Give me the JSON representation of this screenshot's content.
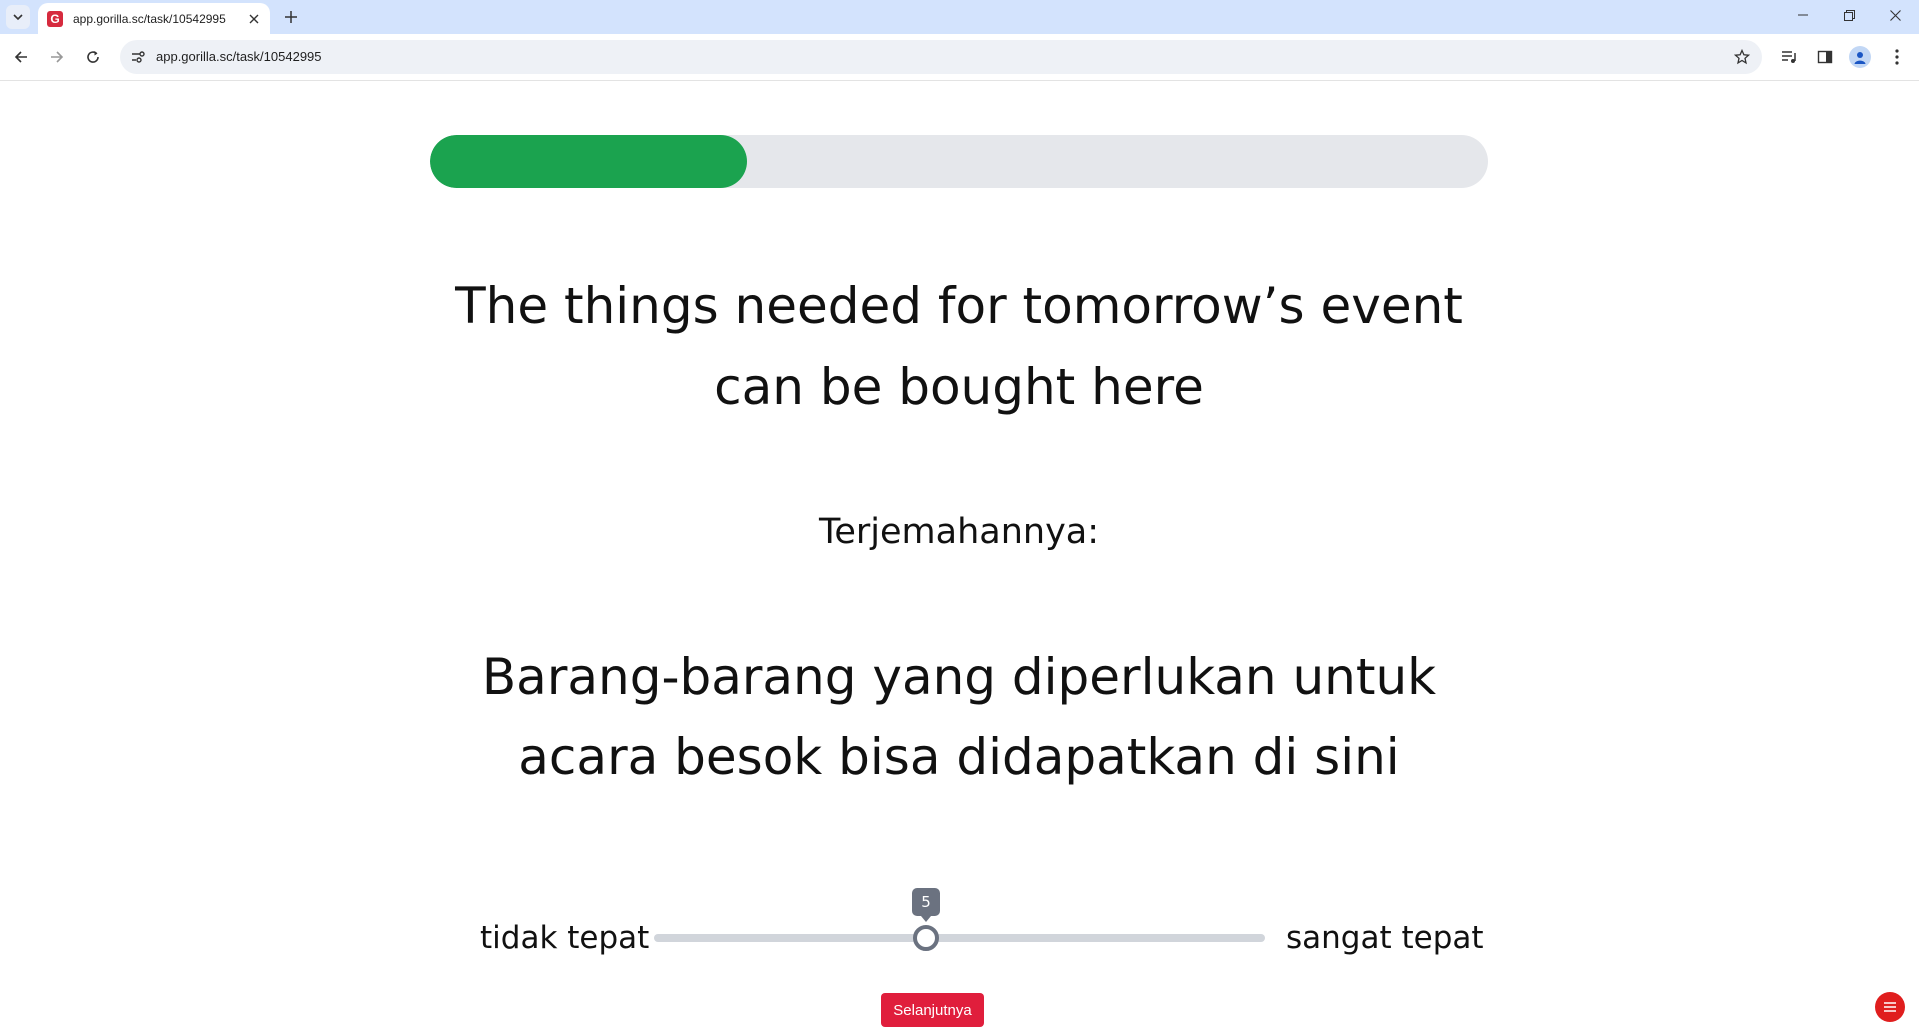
{
  "browser": {
    "tab_title": "app.gorilla.sc/task/10542995",
    "favicon_letter": "G",
    "url": "app.gorilla.sc/task/10542995",
    "icons": [
      "tab-search-icon",
      "close-icon",
      "plus-icon",
      "minimize-icon",
      "restore-icon",
      "close-window-icon",
      "back-icon",
      "forward-icon",
      "reload-icon",
      "site-info-icon",
      "star-icon",
      "media-icon",
      "side-panel-icon",
      "profile-icon",
      "kebab-menu-icon"
    ]
  },
  "task": {
    "progress_fraction": 0.3,
    "progress_color": "#1ba34f",
    "sentence_en_line1": "The things needed for tomorrow’s event",
    "sentence_en_line2": "can be bought here",
    "translation_label": "Terjemahannya:",
    "sentence_id_line1": "Barang-barang yang diperlukan untuk",
    "sentence_id_line2": "acara besok bisa didapatkan di sini",
    "scale": {
      "left_label": "tidak tepat",
      "right_label": "sangat tepat",
      "min": 1,
      "max": 10,
      "value": 5,
      "value_label": "5"
    },
    "next_button_label": "Selanjutnya",
    "accent_color": "#e01e3c",
    "menu_icon": "hamburger-menu-icon"
  }
}
